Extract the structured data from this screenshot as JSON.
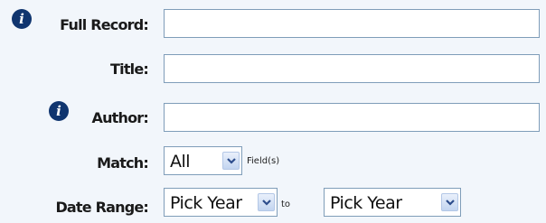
{
  "form": {
    "full_record": {
      "label": "Full Record:",
      "value": ""
    },
    "title": {
      "label": "Title:",
      "value": ""
    },
    "author": {
      "label": "Author:",
      "value": ""
    },
    "match": {
      "label": "Match:",
      "selected": "All",
      "suffix": "Field(s)"
    },
    "date_range": {
      "label": "Date Range:",
      "from_selected": "Pick Year",
      "separator": "to",
      "to_selected": "Pick Year"
    }
  },
  "icons": {
    "info": "info-icon",
    "dropdown": "chevron-down-icon"
  },
  "colors": {
    "background": "#f2f6fb",
    "input_border": "#7f9db9",
    "info_icon": "#10356f",
    "arrow_button": "#c3d5f0"
  }
}
